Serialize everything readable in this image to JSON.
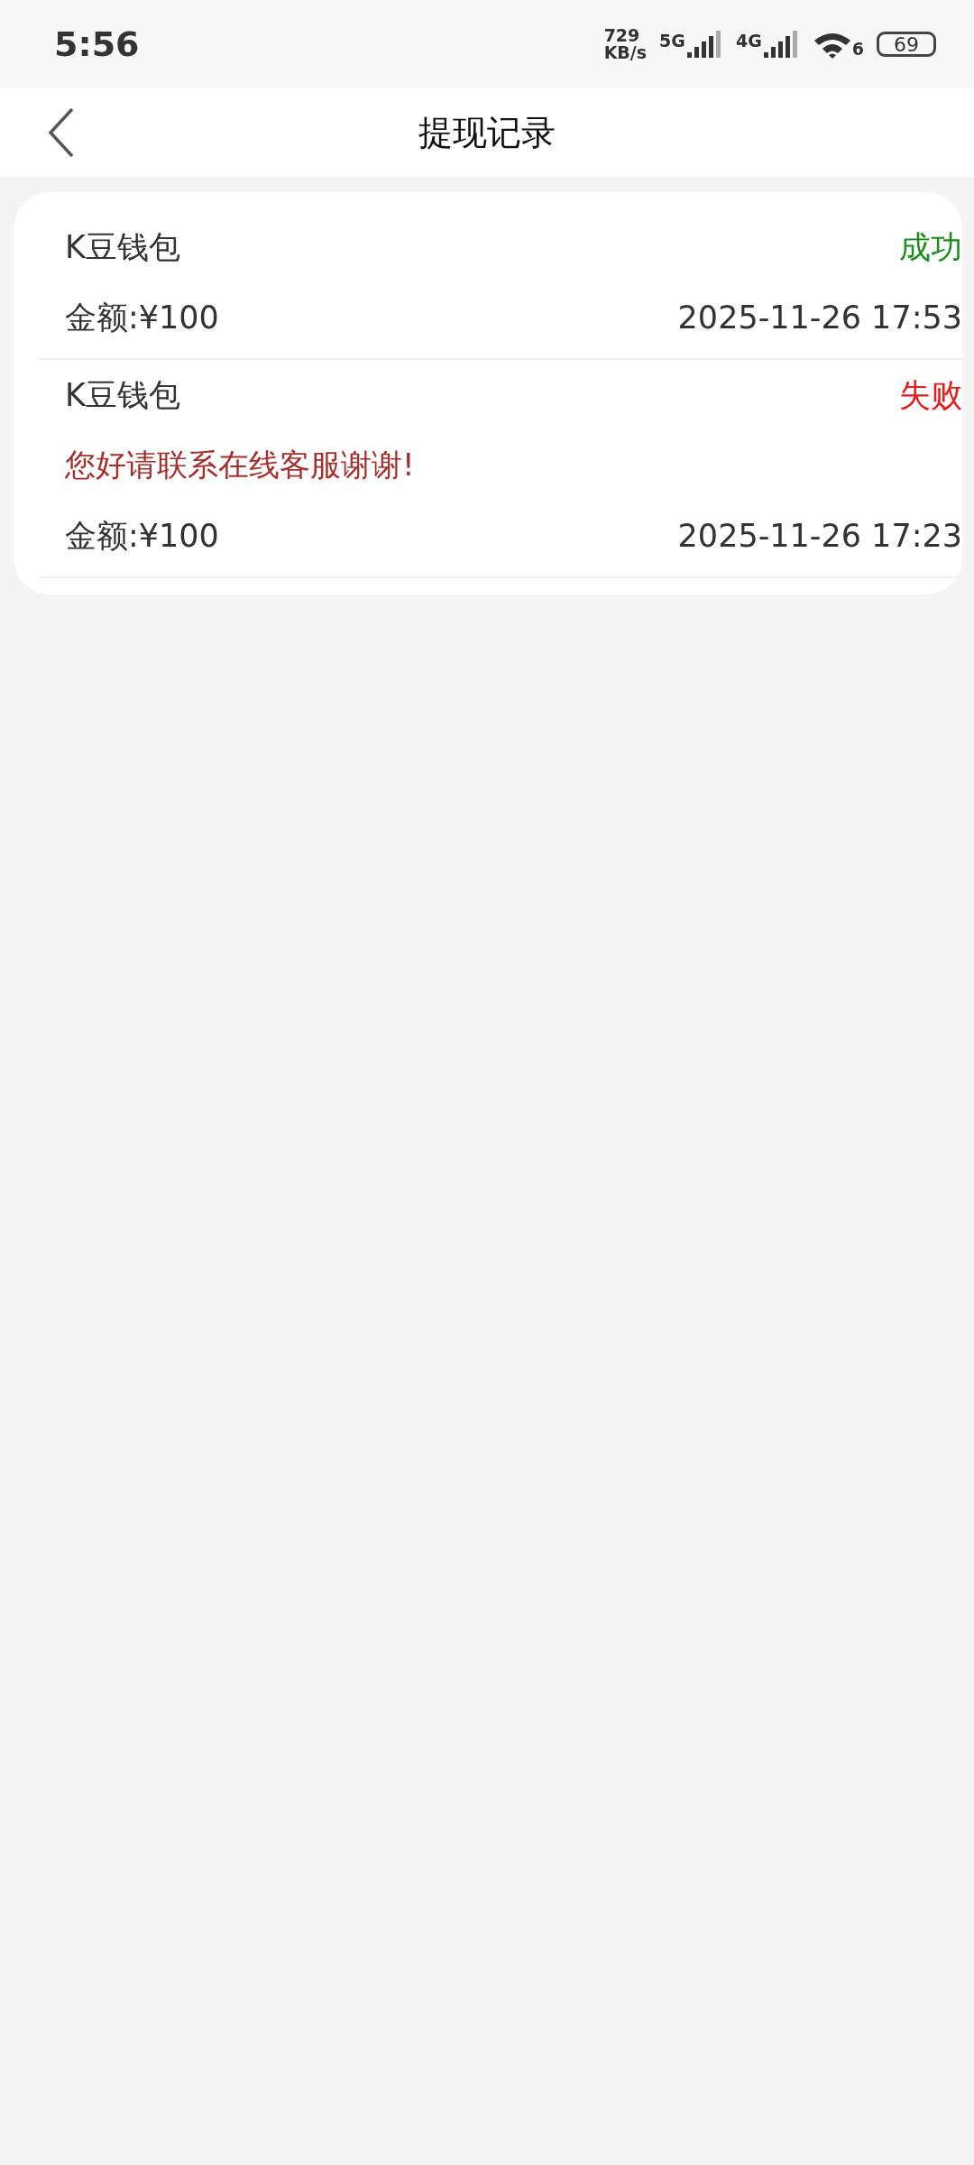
{
  "status_bar": {
    "time": "5:56",
    "speed_value": "729",
    "speed_unit": "KB/s",
    "sim_1": "5G",
    "sim_2": "4G",
    "wifi_badge": "6",
    "battery": "69"
  },
  "header": {
    "title": "提现记录"
  },
  "records": [
    {
      "wallet": "K豆钱包",
      "status": "成功",
      "kind": "success",
      "amount": "金额:¥100",
      "time": "2025-11-26 17:53"
    },
    {
      "wallet": "K豆钱包",
      "status": "失败",
      "kind": "failed",
      "message": "您好请联系在线客服谢谢!",
      "amount": "金额:¥100",
      "time": "2025-11-26 17:23"
    }
  ]
}
